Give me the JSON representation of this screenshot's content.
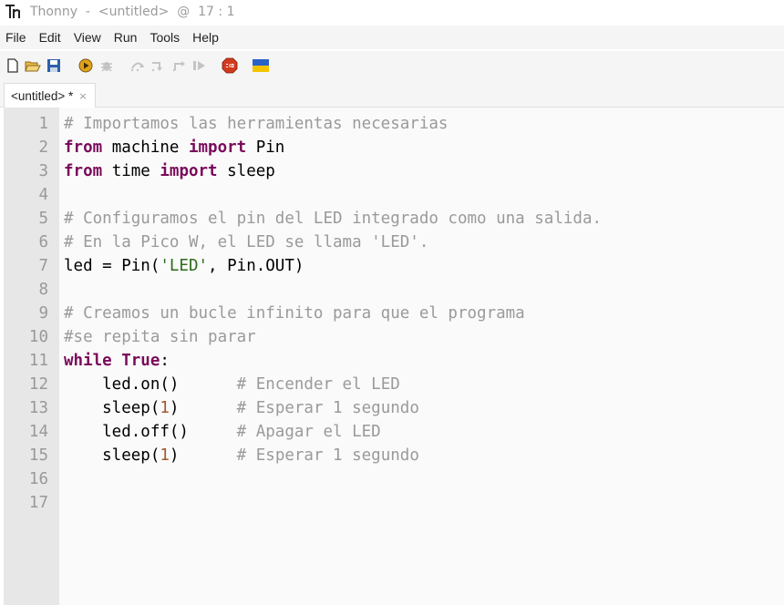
{
  "window": {
    "title": "Thonny  -  <untitled>  @  17 : 1"
  },
  "menu": [
    "File",
    "Edit",
    "View",
    "Run",
    "Tools",
    "Help"
  ],
  "toolbar": {
    "icons": [
      "new-file-icon",
      "open-file-icon",
      "save-icon",
      "run-icon",
      "debug-icon",
      "step-over-icon",
      "step-into-icon",
      "step-out-icon",
      "resume-icon",
      "stop-icon",
      "ukraine-flag-icon"
    ]
  },
  "tab": {
    "label": "<untitled> *",
    "close": "×"
  },
  "editor": {
    "line_numbers": [
      "1",
      "2",
      "3",
      "4",
      "5",
      "6",
      "7",
      "8",
      "9",
      "10",
      "11",
      "12",
      "13",
      "14",
      "15",
      "16",
      "17"
    ],
    "lines": [
      {
        "comment": "# Importamos las herramientas necesarias"
      },
      {
        "kw1": "from",
        "t1": " machine ",
        "kw2": "import",
        "t2": " Pin"
      },
      {
        "kw1": "from",
        "t1": " time ",
        "kw2": "import",
        "t2": " sleep"
      },
      {},
      {
        "comment": "# Configuramos el pin del LED integrado como una salida."
      },
      {
        "comment": "# En la Pico W, el LED se llama 'LED'."
      },
      {
        "t1": "led = Pin(",
        "str": "'LED'",
        "t2": ", Pin.OUT)"
      },
      {},
      {
        "comment": "# Creamos un bucle infinito para que el programa"
      },
      {
        "comment": "#se repita sin parar"
      },
      {
        "kw1": "while",
        "t1": " ",
        "kw2": "True",
        "t2": ":"
      },
      {
        "t1": "    led.on()",
        "pad": "      ",
        "comment": "# Encender el LED"
      },
      {
        "t1": "    sleep(",
        "num": "1",
        "t2": ")",
        "pad": "      ",
        "comment": "# Esperar 1 segundo"
      },
      {
        "t1": "    led.off()",
        "pad": "     ",
        "comment": "# Apagar el LED"
      },
      {
        "t1": "    sleep(",
        "num": "1",
        "t2": ")",
        "pad": "      ",
        "comment": "# Esperar 1 segundo"
      },
      {},
      {}
    ]
  },
  "colors": {
    "comment": "#9a9a9a",
    "keyword": "#7a0a5a",
    "string": "#2e6b1a",
    "number": "#a0582c"
  }
}
